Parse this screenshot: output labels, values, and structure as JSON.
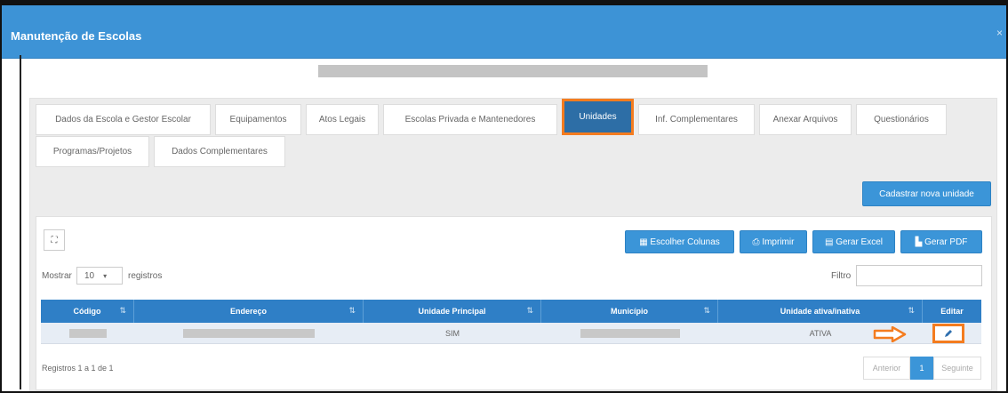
{
  "window": {
    "title": "Manutenção de Escolas"
  },
  "tabs": [
    {
      "label": "Dados da Escola e Gestor Escolar"
    },
    {
      "label": "Equipamentos"
    },
    {
      "label": "Atos Legais"
    },
    {
      "label": "Escolas Privada e Mantenedores"
    },
    {
      "label": "Unidades"
    },
    {
      "label": "Inf. Complementares"
    },
    {
      "label": "Anexar Arquivos"
    },
    {
      "label": "Questionários"
    },
    {
      "label": "Programas/Projetos"
    },
    {
      "label": "Dados Complementares"
    }
  ],
  "actions": {
    "new_unit": "Cadastrar nova unidade",
    "choose_columns": "Escolher Colunas",
    "print": "Imprimir",
    "excel": "Gerar Excel",
    "pdf": "Gerar PDF"
  },
  "table_controls": {
    "show_label": "Mostrar",
    "page_size": "10",
    "records_label": "registros",
    "filter_label": "Filtro"
  },
  "table": {
    "headers": [
      "Código",
      "Endereço",
      "Unidade Principal",
      "Município",
      "Unidade ativa/inativa",
      "Editar"
    ],
    "rows": [
      {
        "principal": "SIM",
        "status": "ATIVA"
      }
    ]
  },
  "footer": {
    "info": "Registros 1 a 1 de 1",
    "prev": "Anterior",
    "page": "1",
    "next": "Seguinte"
  },
  "colors": {
    "header_blue": "#3d93d6",
    "accent_orange": "#f47c1f",
    "table_head": "#2f7fc6"
  }
}
